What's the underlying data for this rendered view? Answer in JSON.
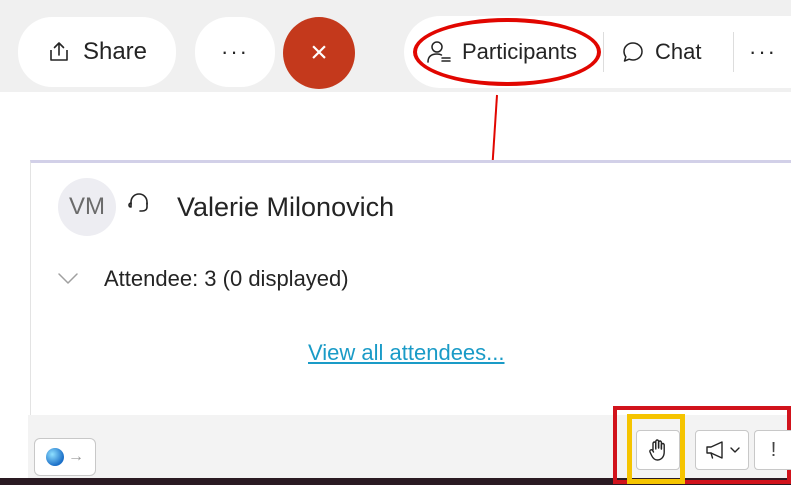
{
  "toolbar": {
    "share_label": "Share",
    "more_label": "···",
    "leave_symbol": "×",
    "participants_label": "Participants",
    "chat_label": "Chat",
    "more_label_2": "···"
  },
  "participants_panel": {
    "presenter": {
      "initials": "VM",
      "name": "Valerie Milonovich"
    },
    "attendee_section": "Attendee: 3 (0 displayed)",
    "view_all_link": "View all attendees..."
  },
  "bottom_bar": {
    "app_arrow": "→",
    "more_symbol": "!"
  },
  "annotations": {
    "ellipse_color": "#e10600",
    "arrow_red_color": "#e10600",
    "arrow_yellow_color": "#f5c400",
    "box_red_color": "#d1131c",
    "box_yellow_color": "#f5c400"
  },
  "icons": {
    "share": "share-icon",
    "participants": "participants-icon",
    "chat": "chat-bubble-icon",
    "headset": "headset-icon",
    "chevron": "chevron-down-icon",
    "raise_hand": "raise-hand-icon",
    "megaphone": "megaphone-icon"
  }
}
